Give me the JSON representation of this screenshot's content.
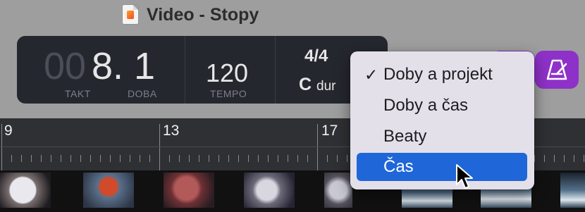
{
  "window": {
    "title": "Video - Stopy"
  },
  "lcd": {
    "bar_dim": "00",
    "bar_value": "8. 1",
    "bar_label": "TAKT",
    "beat_label": "DOBA",
    "tempo": "120",
    "tempo_label": "TEMPO",
    "time_signature": "4/4",
    "key_note": "C",
    "key_mode": "dur"
  },
  "ruler": {
    "markers": [
      "9",
      "13",
      "17"
    ]
  },
  "menu": {
    "items": [
      {
        "label": "Doby a projekt",
        "checked": true
      },
      {
        "label": "Doby a čas",
        "checked": false
      },
      {
        "label": "Beaty",
        "checked": false
      },
      {
        "label": "Čas",
        "checked": false,
        "highlighted": true
      }
    ],
    "checkmark": "✓"
  },
  "icons": {
    "document": "document-icon",
    "metronome": "metronome-icon",
    "pointer": "pointer-cursor-icon"
  },
  "colors": {
    "accent_purple": "#8e31c9",
    "selection_blue": "#1f67d8",
    "lcd_background": "#25272e"
  }
}
